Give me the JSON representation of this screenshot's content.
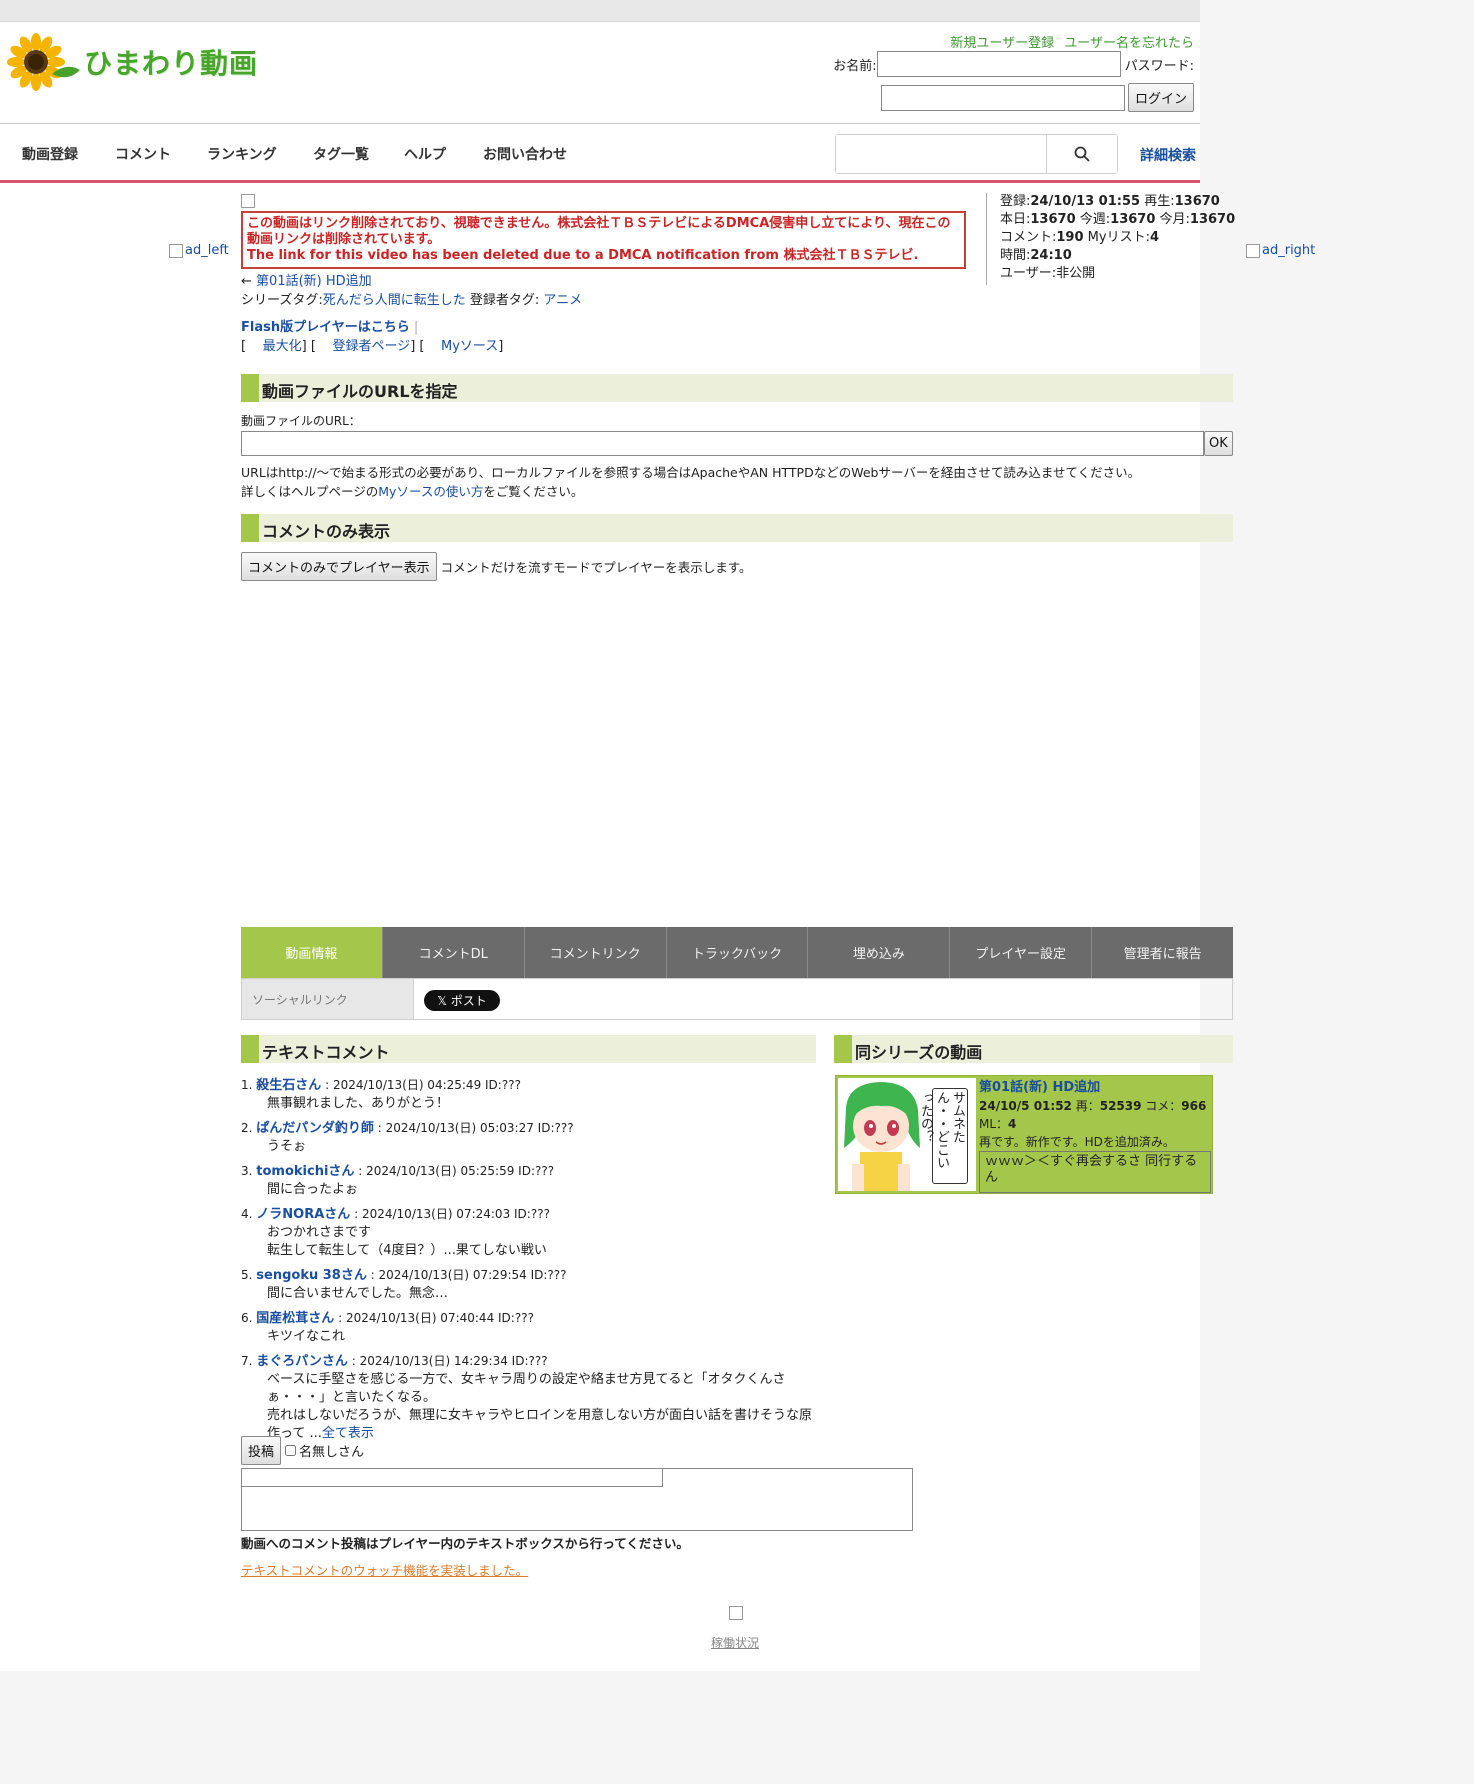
{
  "site": {
    "logo_text": "ひまわり動画"
  },
  "header": {
    "register_link": "新規ユーザー登録",
    "forgot_link": "ユーザー名を忘れたら",
    "name_label": "お名前:",
    "password_label": "パスワード:",
    "login_button": "ログイン"
  },
  "nav": {
    "items": [
      "動画登録",
      "コメント",
      "ランキング",
      "タグ一覧",
      "ヘルプ",
      "お問い合わせ"
    ],
    "advanced_search": "詳細検索"
  },
  "ads": {
    "left": "ad_left",
    "right": "ad_right"
  },
  "video": {
    "dmca_jp": "この動画はリンク削除されており、視聴できません。株式会社ＴＢＳテレビによるDMCA侵害申し立てにより、現在この動画リンクは削除されています。",
    "dmca_en": "The link for this video has been deleted due to a DMCA notification from 株式会社ＴＢＳテレビ.",
    "prev_arrow": "←",
    "prev_link": "第01話(新) HD追加",
    "series_tag_label": "シリーズタグ:",
    "series_tag": "死んだら人間に転生した",
    "registrant_tag_label": "登録者タグ:",
    "registrant_tag": "アニメ",
    "flash_link": "Flash版プレイヤーはこちら",
    "maximize": "最大化",
    "registrant_page": "登録者ページ",
    "my_source": "Myソース"
  },
  "stats": {
    "registered_label": "登録:",
    "registered": "24/10/13 01:55",
    "plays_label": "再生:",
    "plays": "13670",
    "today_label": "本日:",
    "today": "13670",
    "week_label": "今週:",
    "week": "13670",
    "month_label": "今月:",
    "month": "13670",
    "comments_label": "コメント:",
    "comments": "190",
    "mylist_label": "Myリスト:",
    "mylist": "4",
    "duration_label": "時間:",
    "duration": "24:10",
    "user_label": "ユーザー:",
    "user": "非公開"
  },
  "url_section": {
    "heading": "動画ファイルのURLを指定",
    "label": "動画ファイルのURL：",
    "ok_button": "OK",
    "note1": "URLはhttp://〜で始まる形式の必要があり、ローカルファイルを参照する場合はApacheやAN HTTPDなどのWebサーバーを経由させて読み込ませてください。",
    "note2_pre": "詳しくはヘルプページの",
    "note2_link": "Myソースの使い方",
    "note2_post": "をご覧ください。"
  },
  "comment_only": {
    "heading": "コメントのみ表示",
    "button": "コメントのみでプレイヤー表示",
    "desc": "コメントだけを流すモードでプレイヤーを表示します。"
  },
  "tabs": [
    "動画情報",
    "コメントDL",
    "コメントリンク",
    "トラックバック",
    "埋め込み",
    "プレイヤー設定",
    "管理者に報告"
  ],
  "social": {
    "label": "ソーシャルリンク",
    "x_button": "𝕏 ポスト"
  },
  "text_comments": {
    "heading": "テキストコメント",
    "items": [
      {
        "num": "1.",
        "name": "殺生石さん",
        "meta": " : 2024/10/13(日) 04:25:49 ID:???",
        "lines": [
          "無事観れました、ありがとう！"
        ]
      },
      {
        "num": "2.",
        "name": "ぱんだパンダ釣り師",
        "meta": " : 2024/10/13(日) 05:03:27 ID:???",
        "lines": [
          "うそぉ"
        ]
      },
      {
        "num": "3.",
        "name": "tomokichiさん",
        "meta": " : 2024/10/13(日) 05:25:59 ID:???",
        "lines": [
          "間に合ったよぉ"
        ]
      },
      {
        "num": "4.",
        "name": "ノラNORAさん",
        "meta": " : 2024/10/13(日) 07:24:03 ID:???",
        "lines": [
          "おつかれさまです",
          "転生して転生して（4度目？）...果てしない戦い"
        ]
      },
      {
        "num": "5.",
        "name": "sengoku 38さん",
        "meta": " : 2024/10/13(日) 07:29:54 ID:???",
        "lines": [
          "間に合いませんでした。無念…"
        ]
      },
      {
        "num": "6.",
        "name": "国産松茸さん",
        "meta": " : 2024/10/13(日) 07:40:44 ID:???",
        "lines": [
          "キツイなこれ"
        ]
      },
      {
        "num": "7.",
        "name": "まぐろパンさん",
        "meta": " : 2024/10/13(日) 14:29:34 ID:???",
        "lines": [
          "ベースに手堅さを感じる一方で、女キャラ周りの設定や絡ませ方見てると「オタクくんさぁ・・・」と言いたくなる。",
          "売れはしないだろうが、無理に女キャラやヒロインを用意しない方が面白い話を書けそうな原作って ..."
        ],
        "more": "全て表示"
      }
    ],
    "post_button": "投稿",
    "anon_label": "名無しさん",
    "notice": "動画へのコメント投稿はプレイヤー内のテキストボックスから行ってください。",
    "watch_link": "テキストコメントのウォッチ機能を実装しました。"
  },
  "series": {
    "heading": "同シリーズの動画",
    "thumb_text": "サムネたん・・どこいったの？",
    "title": "第01話(新) HD追加",
    "date": "24/10/5 01:52",
    "play_label": " 再：",
    "plays": "52539",
    "comment_label": " コメ：",
    "comments": "966",
    "ml_label": " ML：",
    "ml": "4",
    "desc": "再です。新作です。HDを追加済み。",
    "last_comment": "ｗｗｗ＞＜すぐ再会するさ 同行するん"
  },
  "footer": {
    "status_link": "稼働状況"
  }
}
